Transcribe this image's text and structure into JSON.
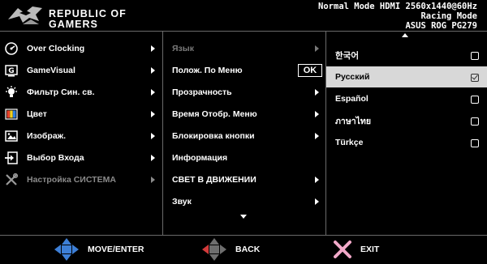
{
  "header": {
    "brand_line1": "REPUBLIC OF",
    "brand_line2": "GAMERS",
    "status_lines": [
      "Normal Mode HDMI 2560x1440@60Hz",
      "Racing Mode",
      "ASUS ROG PG279"
    ]
  },
  "main_menu": {
    "items": [
      {
        "label": "Over Clocking",
        "icon": "speedometer-icon"
      },
      {
        "label": "GameVisual",
        "icon": "gamevisual-icon"
      },
      {
        "label": "Фильтр Син. св.",
        "icon": "bulb-icon"
      },
      {
        "label": "Цвет",
        "icon": "color-palette-icon"
      },
      {
        "label": "Изображ.",
        "icon": "picture-icon"
      },
      {
        "label": "Выбор Входа",
        "icon": "input-icon"
      },
      {
        "label": "Настройка СИСТЕМА",
        "icon": "wrench-icon"
      }
    ]
  },
  "submenu": {
    "items": [
      {
        "label": "Язык"
      },
      {
        "label": "Полож. По Меню",
        "ok_label": "OK"
      },
      {
        "label": "Прозрачность"
      },
      {
        "label": "Время Отобр. Меню"
      },
      {
        "label": "Блокировка кнопки"
      },
      {
        "label": "Информация"
      },
      {
        "label": "СВЕТ В ДВИЖЕНИИ"
      },
      {
        "label": "Звук"
      }
    ]
  },
  "languages": {
    "items": [
      {
        "label": "한국어",
        "checked": false
      },
      {
        "label": "Русский",
        "checked": true
      },
      {
        "label": "Español",
        "checked": false
      },
      {
        "label": "ภาษาไทย",
        "checked": false
      },
      {
        "label": "Türkçe",
        "checked": false
      }
    ]
  },
  "footer": {
    "move_enter": "MOVE/ENTER",
    "back": "BACK",
    "exit": "EXIT"
  },
  "colors": {
    "background": "#000000",
    "selected_row": "#d8d8d8",
    "dpad_blue": "#3d7fd6",
    "dpad_gray": "#6e6e6e",
    "exit_pink": "#f2a9c9"
  }
}
